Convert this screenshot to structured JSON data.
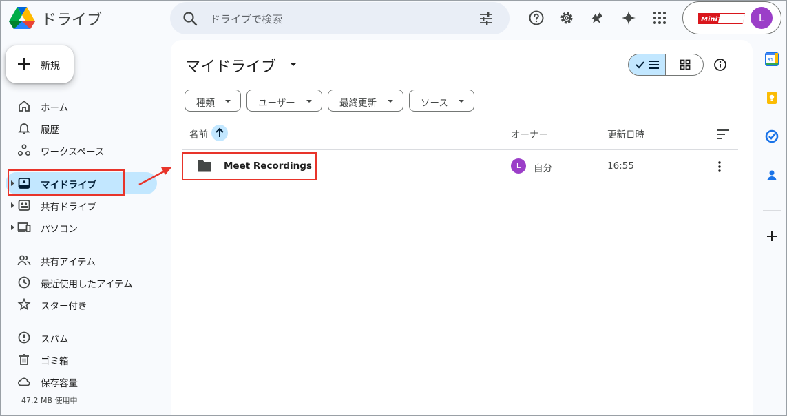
{
  "header": {
    "app_name": "ドライブ",
    "search_placeholder": "ドライブで検索",
    "brand_logo_text": "MiniTool",
    "avatar_letter": "L",
    "icons": [
      "help-icon",
      "settings-icon",
      "gemini-shortcut-icon",
      "sparkle-icon",
      "apps-grid-icon"
    ]
  },
  "new_button": {
    "label": "新規"
  },
  "sidebar": {
    "items": [
      {
        "label": "ホーム",
        "icon": "home-icon"
      },
      {
        "label": "履歴",
        "icon": "bell-icon"
      },
      {
        "label": "ワークスペース",
        "icon": "workspace-icon"
      },
      {
        "label": "マイドライブ",
        "icon": "my-drive-icon",
        "active": true
      },
      {
        "label": "共有ドライブ",
        "icon": "shared-drive-icon"
      },
      {
        "label": "パソコン",
        "icon": "computer-icon"
      },
      {
        "label": "共有アイテム",
        "icon": "people-icon"
      },
      {
        "label": "最近使用したアイテム",
        "icon": "clock-icon"
      },
      {
        "label": "スター付き",
        "icon": "star-icon"
      },
      {
        "label": "スパム",
        "icon": "spam-icon"
      },
      {
        "label": "ゴミ箱",
        "icon": "trash-icon"
      },
      {
        "label": "保存容量",
        "icon": "cloud-icon"
      }
    ],
    "storage_used": "47.2 MB 使用中"
  },
  "main": {
    "title": "マイドライブ",
    "filters": [
      "種類",
      "ユーザー",
      "最終更新",
      "ソース"
    ],
    "columns": {
      "name": "名前",
      "owner": "オーナー",
      "modified": "更新日時"
    },
    "rows": [
      {
        "name": "Meet Recordings",
        "owner_avatar": "L",
        "owner": "自分",
        "modified": "16:55"
      }
    ]
  },
  "colors": {
    "accent": "#c2e7ff",
    "highlight_red": "#e8342a",
    "avatar": "#9b3ec8",
    "search_bg": "#e9eef6"
  }
}
